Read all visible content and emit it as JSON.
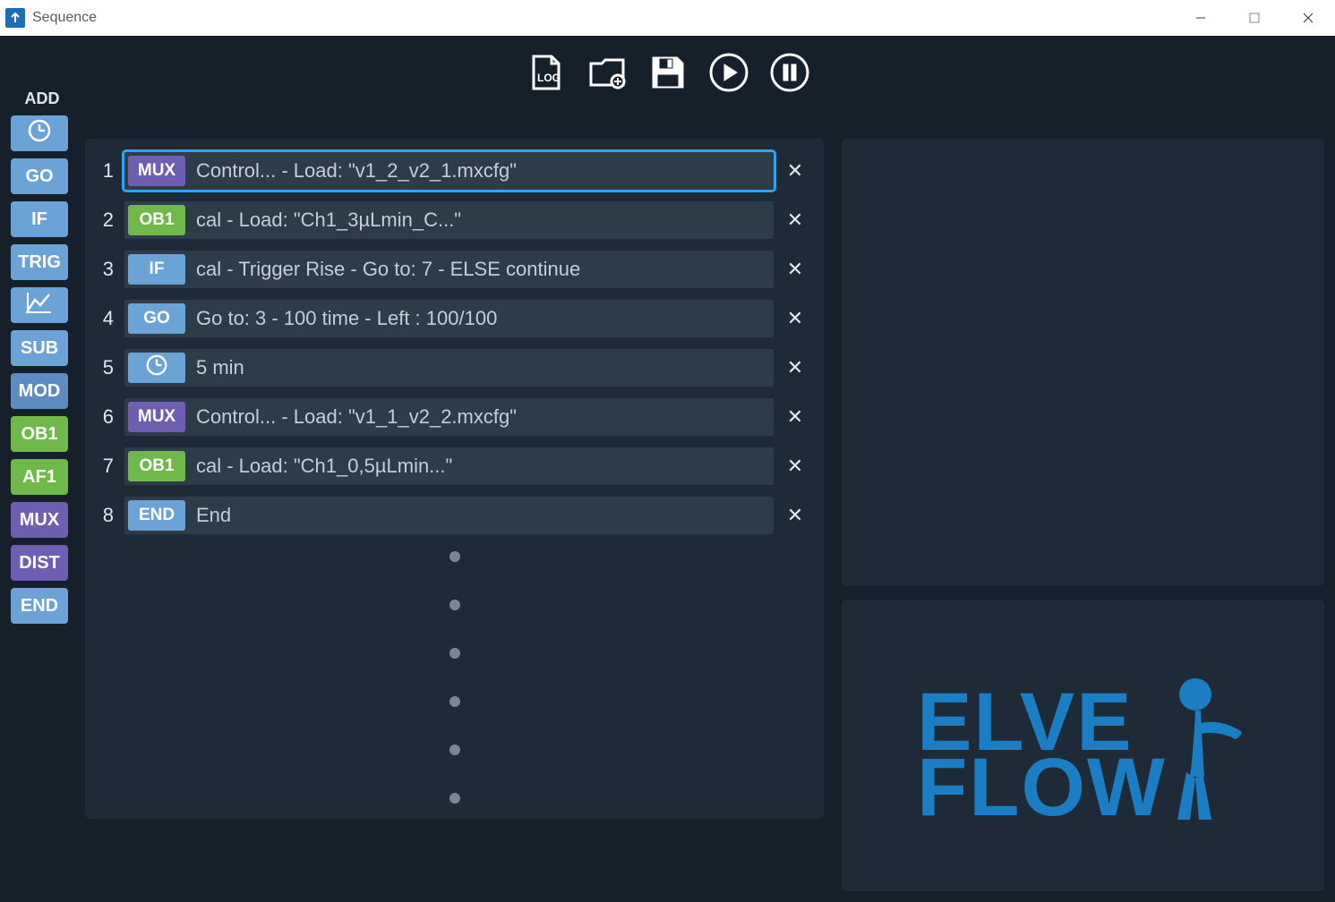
{
  "window": {
    "title": "Sequence"
  },
  "toolbar": {
    "log": "LOG",
    "open": "open-folder",
    "save": "save",
    "play": "play",
    "pause": "pause"
  },
  "sidebar": {
    "title": "ADD",
    "items": [
      {
        "kind": "icon",
        "icon": "clock",
        "color": "c-blue"
      },
      {
        "kind": "text",
        "label": "GO",
        "color": "c-blue"
      },
      {
        "kind": "text",
        "label": "IF",
        "color": "c-blue"
      },
      {
        "kind": "text",
        "label": "TRIG",
        "color": "c-blue"
      },
      {
        "kind": "icon",
        "icon": "graph",
        "color": "c-blue"
      },
      {
        "kind": "text",
        "label": "SUB",
        "color": "c-blue"
      },
      {
        "kind": "text",
        "label": "MOD",
        "color": "c-bluealt"
      },
      {
        "kind": "text",
        "label": "OB1",
        "color": "c-green"
      },
      {
        "kind": "text",
        "label": "AF1",
        "color": "c-green"
      },
      {
        "kind": "text",
        "label": "MUX",
        "color": "c-purple"
      },
      {
        "kind": "text",
        "label": "DIST",
        "color": "c-purple"
      },
      {
        "kind": "text",
        "label": "END",
        "color": "c-blue"
      }
    ]
  },
  "steps": [
    {
      "num": "1",
      "tag": "MUX",
      "tagColor": "c-purple",
      "text": "Control... - Load: \"v1_2_v2_1.mxcfg\"",
      "selected": true
    },
    {
      "num": "2",
      "tag": "OB1",
      "tagColor": "c-green",
      "text": "cal - Load: \"Ch1_3µLmin_C...\"",
      "selected": false
    },
    {
      "num": "3",
      "tag": "IF",
      "tagColor": "c-blue",
      "text": "cal - Trigger Rise - Go to: 7 - ELSE continue",
      "selected": false
    },
    {
      "num": "4",
      "tag": "GO",
      "tagColor": "c-blue",
      "text": "Go to: 3 - 100 time - Left : 100/100",
      "selected": false
    },
    {
      "num": "5",
      "tag": "icon-clock",
      "tagColor": "c-blue",
      "text": "5 min",
      "selected": false
    },
    {
      "num": "6",
      "tag": "MUX",
      "tagColor": "c-purple",
      "text": "Control... - Load: \"v1_1_v2_2.mxcfg\"",
      "selected": false
    },
    {
      "num": "7",
      "tag": "OB1",
      "tagColor": "c-green",
      "text": "cal - Load: \"Ch1_0,5µLmin...\"",
      "selected": false
    },
    {
      "num": "8",
      "tag": "END",
      "tagColor": "c-blue",
      "text": "End",
      "selected": false
    }
  ],
  "logo": {
    "line1": "ELVE",
    "line2": "FLOW"
  }
}
